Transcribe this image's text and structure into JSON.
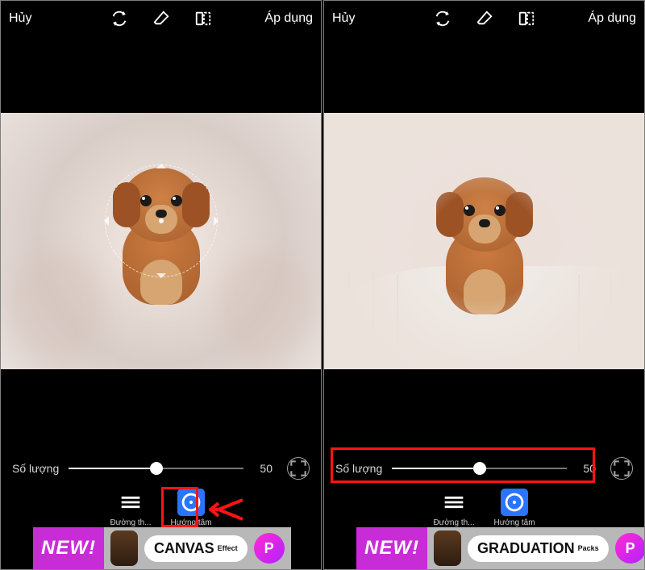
{
  "header": {
    "cancel": "Hủy",
    "apply": "Áp dụng"
  },
  "slider": {
    "label": "Số lượng",
    "value": 50,
    "min": 0,
    "max": 100
  },
  "tools": {
    "linear": {
      "label": "Đường th..."
    },
    "radial": {
      "label": "Hướng tâm",
      "active": true
    }
  },
  "ad": {
    "newLabel": "NEW!",
    "left": {
      "title": "CANVAS",
      "sub": "Effect"
    },
    "right": {
      "title": "GRADUATION",
      "sub": "Packs"
    },
    "logo": "P"
  },
  "annotations": {
    "left_highlight": "radial-tool",
    "right_highlight": "slider-row"
  }
}
